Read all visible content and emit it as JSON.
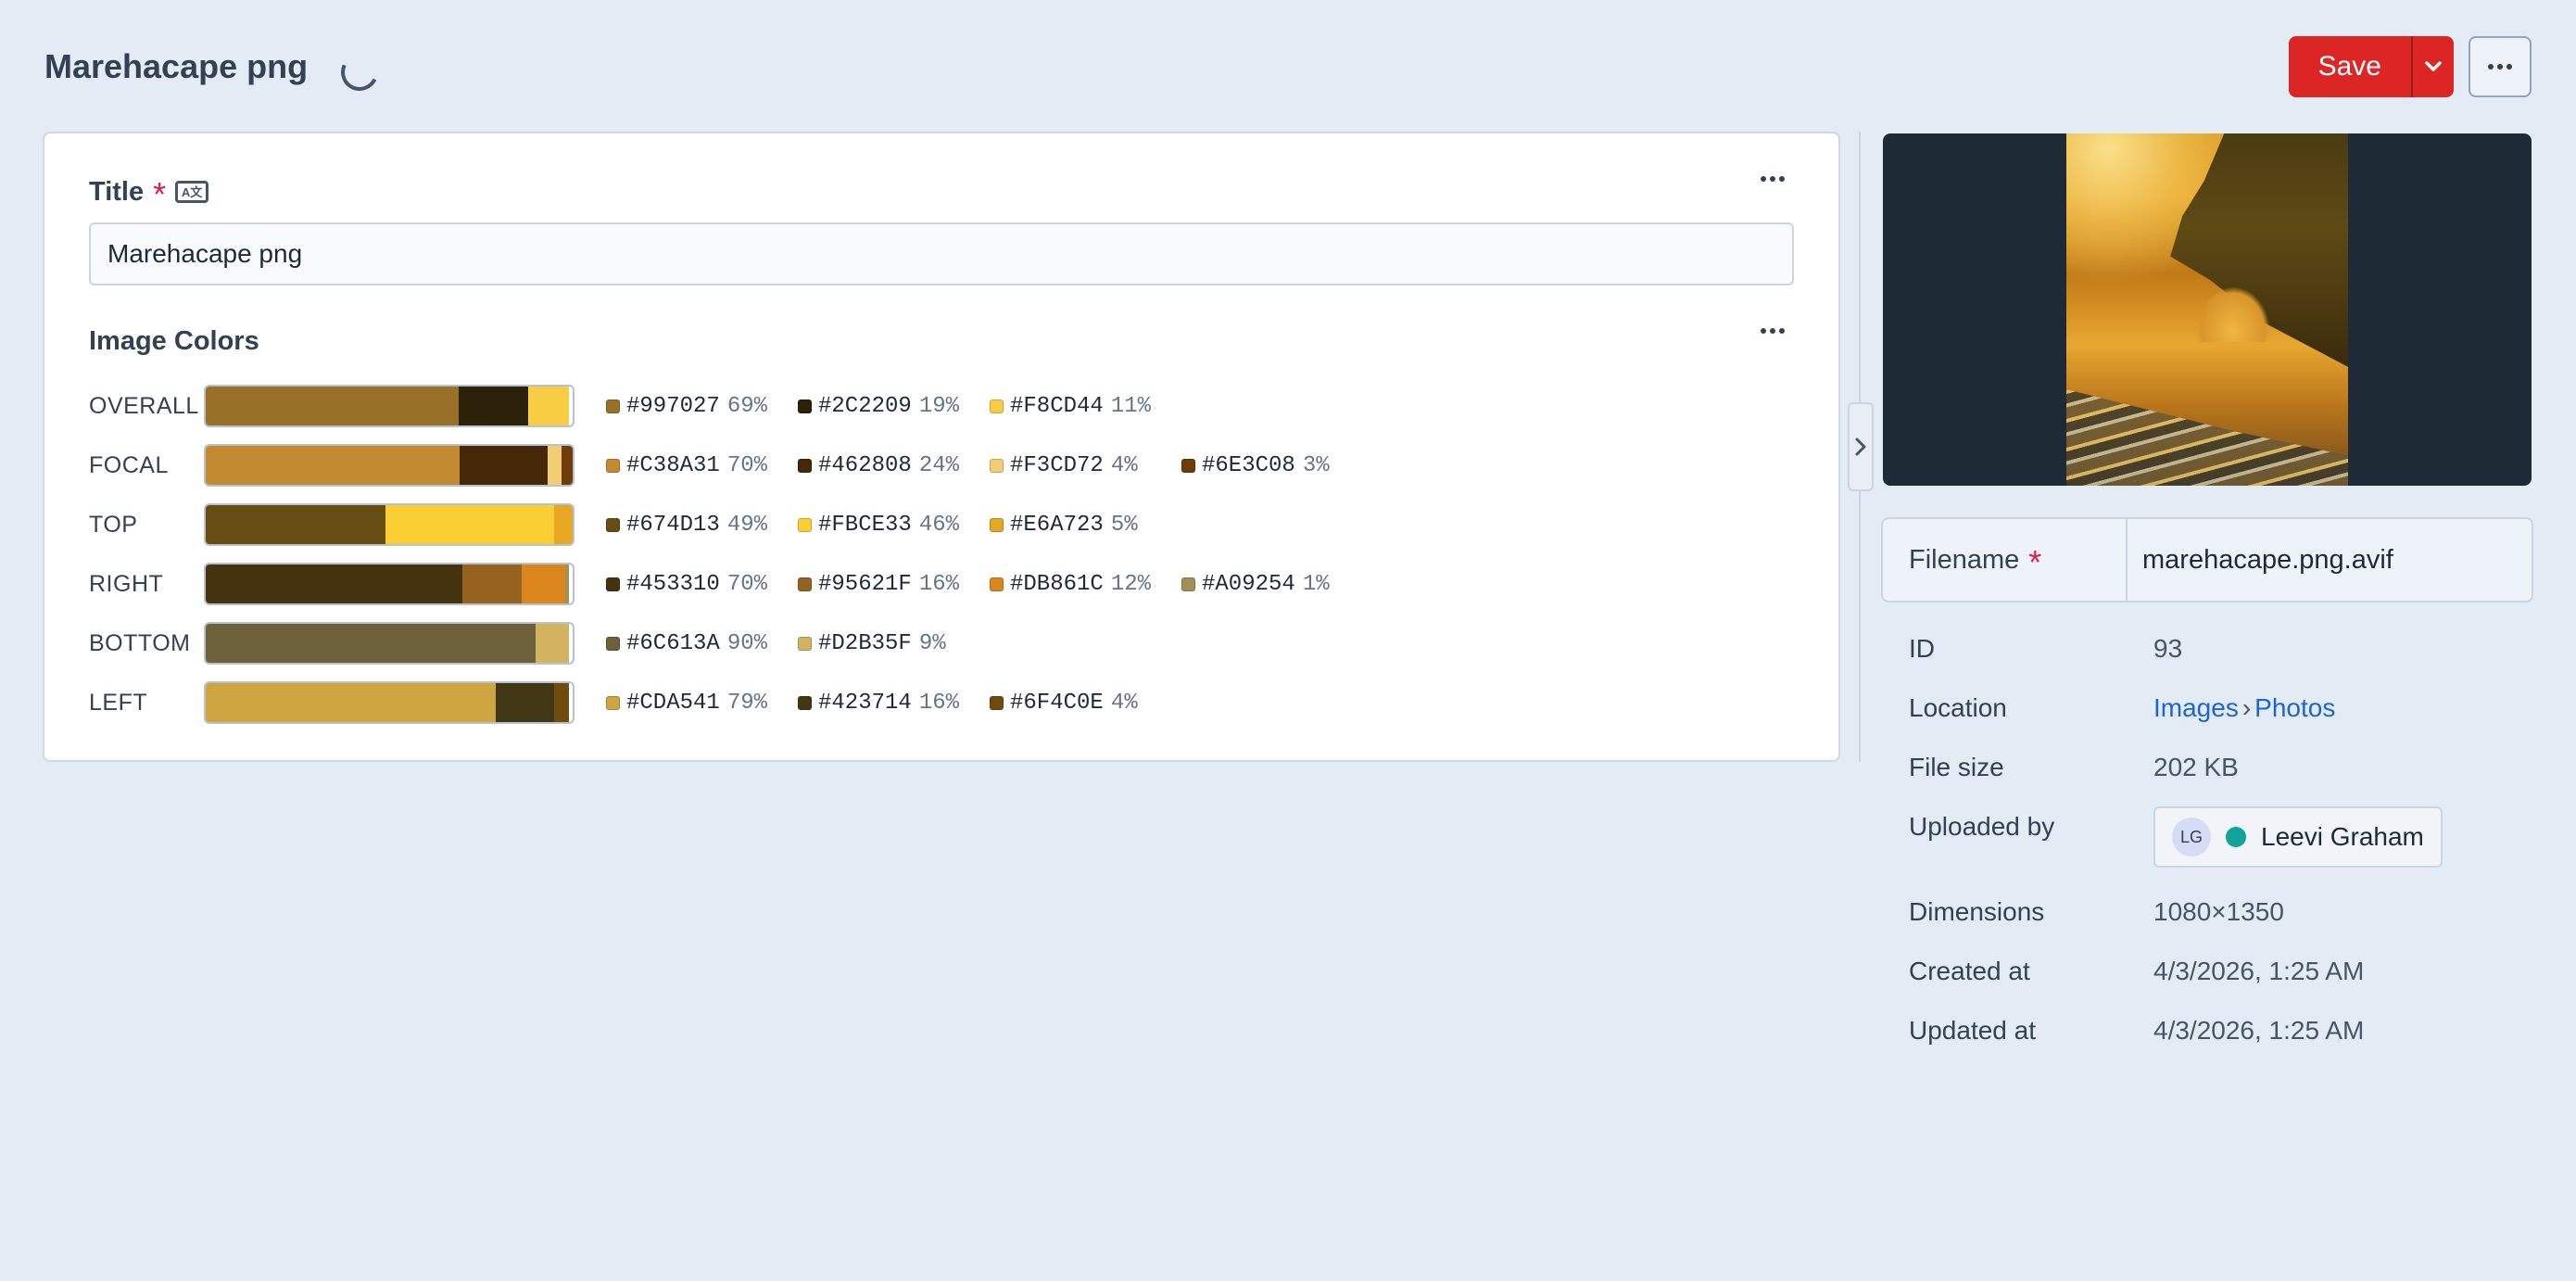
{
  "header": {
    "title": "Marehacape png",
    "save_label": "Save"
  },
  "title_field": {
    "label": "Title",
    "value": "Marehacape png"
  },
  "image_colors": {
    "label": "Image Colors",
    "rows": [
      {
        "name": "OVERALL",
        "swatches": [
          {
            "hex": "#997027",
            "pct": "69%",
            "fraction": 0.69
          },
          {
            "hex": "#2C2209",
            "pct": "19%",
            "fraction": 0.19
          },
          {
            "hex": "#F8CD44",
            "pct": "11%",
            "fraction": 0.11
          }
        ]
      },
      {
        "name": "FOCAL",
        "swatches": [
          {
            "hex": "#C38A31",
            "pct": "70%",
            "fraction": 0.7
          },
          {
            "hex": "#462808",
            "pct": "24%",
            "fraction": 0.24
          },
          {
            "hex": "#F3CD72",
            "pct": "4%",
            "fraction": 0.04
          },
          {
            "hex": "#6E3C08",
            "pct": "3%",
            "fraction": 0.03
          }
        ]
      },
      {
        "name": "TOP",
        "swatches": [
          {
            "hex": "#674D13",
            "pct": "49%",
            "fraction": 0.49
          },
          {
            "hex": "#FBCE33",
            "pct": "46%",
            "fraction": 0.46
          },
          {
            "hex": "#E6A723",
            "pct": "5%",
            "fraction": 0.05
          }
        ]
      },
      {
        "name": "RIGHT",
        "swatches": [
          {
            "hex": "#453310",
            "pct": "70%",
            "fraction": 0.7
          },
          {
            "hex": "#95621F",
            "pct": "16%",
            "fraction": 0.16
          },
          {
            "hex": "#DB861C",
            "pct": "12%",
            "fraction": 0.12
          },
          {
            "hex": "#A09254",
            "pct": "1%",
            "fraction": 0.01
          }
        ]
      },
      {
        "name": "BOTTOM",
        "swatches": [
          {
            "hex": "#6C613A",
            "pct": "90%",
            "fraction": 0.9
          },
          {
            "hex": "#D2B35F",
            "pct": "9%",
            "fraction": 0.09
          }
        ]
      },
      {
        "name": "LEFT",
        "swatches": [
          {
            "hex": "#CDA541",
            "pct": "79%",
            "fraction": 0.79
          },
          {
            "hex": "#423714",
            "pct": "16%",
            "fraction": 0.16
          },
          {
            "hex": "#6F4C0E",
            "pct": "4%",
            "fraction": 0.04
          }
        ]
      }
    ]
  },
  "sidebar": {
    "filename_label": "Filename",
    "filename_value": "marehacape.png.avif",
    "id_label": "ID",
    "id_value": "93",
    "location_label": "Location",
    "location_parent": "Images",
    "location_child": "Photos",
    "filesize_label": "File size",
    "filesize_value": "202 KB",
    "uploaded_label": "Uploaded by",
    "user_initials": "LG",
    "user_name": "Leevi Graham",
    "dimensions_label": "Dimensions",
    "dimensions_value": "1080×1350",
    "created_label": "Created at",
    "created_value": "4/3/2026, 1:25 AM",
    "updated_label": "Updated at",
    "updated_value": "4/3/2026, 1:25 AM"
  },
  "icons": {
    "caret": "chevron-down-icon",
    "more": "ellipsis-icon",
    "collapse": "chevron-right-icon",
    "translate": "translate-icon"
  },
  "colors": {
    "accent": "#dc2626",
    "link": "#1d63d8",
    "required": "#e11d48",
    "user_status": "#14a39a"
  }
}
